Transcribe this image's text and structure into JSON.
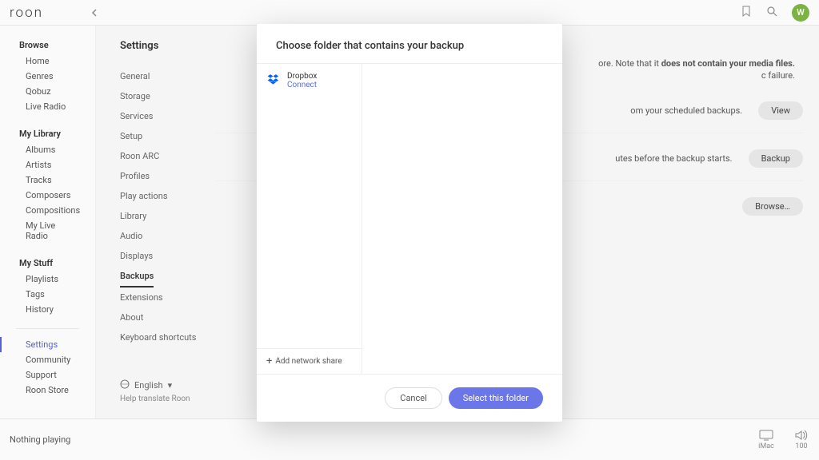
{
  "header": {
    "logo": "roon",
    "avatar_letter": "W"
  },
  "sidebar": {
    "sections": [
      {
        "header": "Browse",
        "items": [
          "Home",
          "Genres",
          "Qobuz",
          "Live Radio"
        ]
      },
      {
        "header": "My Library",
        "items": [
          "Albums",
          "Artists",
          "Tracks",
          "Composers",
          "Compositions",
          "My Live Radio"
        ]
      },
      {
        "header": "My Stuff",
        "items": [
          "Playlists",
          "Tags",
          "History"
        ]
      }
    ],
    "bottom": [
      "Settings",
      "Community",
      "Support",
      "Roon Store"
    ],
    "active": "Settings"
  },
  "settings": {
    "title": "Settings",
    "items": [
      "General",
      "Storage",
      "Services",
      "Setup",
      "Roon ARC",
      "Profiles",
      "Play actions",
      "Library",
      "Audio",
      "Displays",
      "Backups",
      "Extensions",
      "About",
      "Keyboard shortcuts"
    ],
    "active": "Backups",
    "language": "English",
    "help_link": "Help translate Roon"
  },
  "backups": {
    "text1_partial": "ore. Note that it",
    "text1_bold": "does not contain your media files.",
    "text2_partial": "c failure.",
    "row1_partial": "om your scheduled backups.",
    "row2_partial": "utes before the backup starts.",
    "btn_view": "View",
    "btn_backup": "Backup",
    "btn_browse": "Browse…"
  },
  "modal": {
    "title": "Choose folder that contains your backup",
    "dropbox": {
      "name": "Dropbox",
      "connect": "Connect"
    },
    "add_share": "Add network share",
    "cancel": "Cancel",
    "select": "Select this folder"
  },
  "footer": {
    "nothing_playing": "Nothing playing",
    "device": "iMac",
    "volume": "100"
  }
}
